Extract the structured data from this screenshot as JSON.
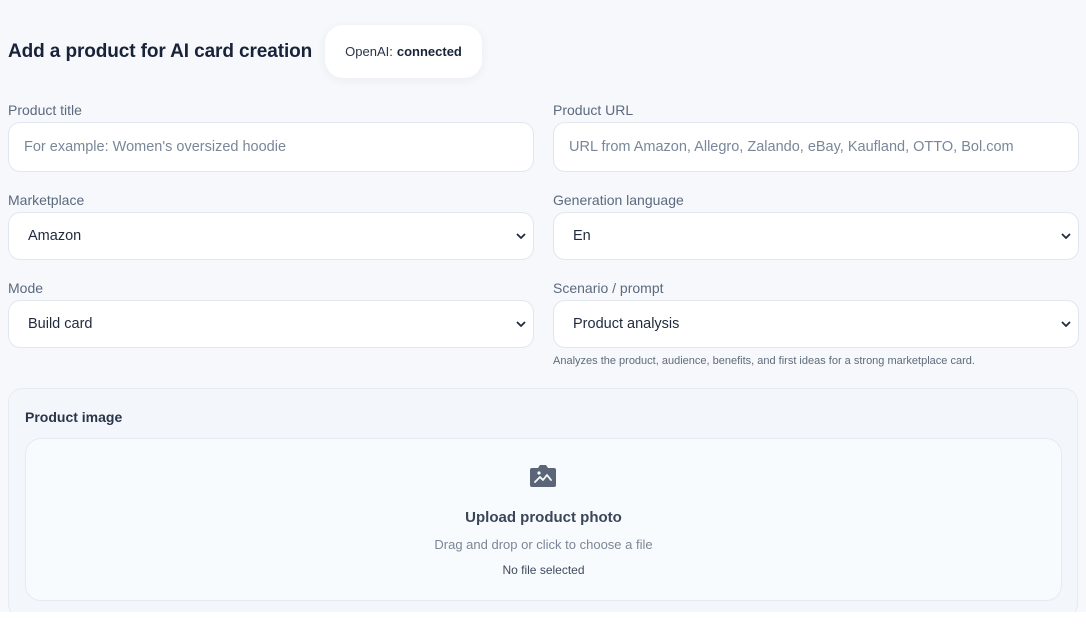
{
  "header": {
    "title": "Add a product for AI card creation",
    "status_prefix": "OpenAI:",
    "status_value": "connected"
  },
  "form": {
    "product_title": {
      "label": "Product title",
      "placeholder": "For example: Women's oversized hoodie",
      "value": ""
    },
    "product_url": {
      "label": "Product URL",
      "placeholder": "URL from Amazon, Allegro, Zalando, eBay, Kaufland, OTTO, Bol.com",
      "value": ""
    },
    "marketplace": {
      "label": "Marketplace",
      "value": "Amazon"
    },
    "generation_language": {
      "label": "Generation language",
      "value": "En"
    },
    "mode": {
      "label": "Mode",
      "value": "Build card"
    },
    "scenario": {
      "label": "Scenario / prompt",
      "value": "Product analysis",
      "hint": "Analyzes the product, audience, benefits, and first ideas for a strong marketplace card."
    }
  },
  "image_upload": {
    "section_title": "Product image",
    "icon": "image-upload-icon",
    "title": "Upload product photo",
    "subtitle": "Drag and drop or click to choose a file",
    "status": "No file selected"
  },
  "colors": {
    "background": "#f6f8fb",
    "card": "#ffffff",
    "title_text": "#18233a",
    "label_text": "#5b6a7f",
    "border": "#e1e7ef"
  }
}
